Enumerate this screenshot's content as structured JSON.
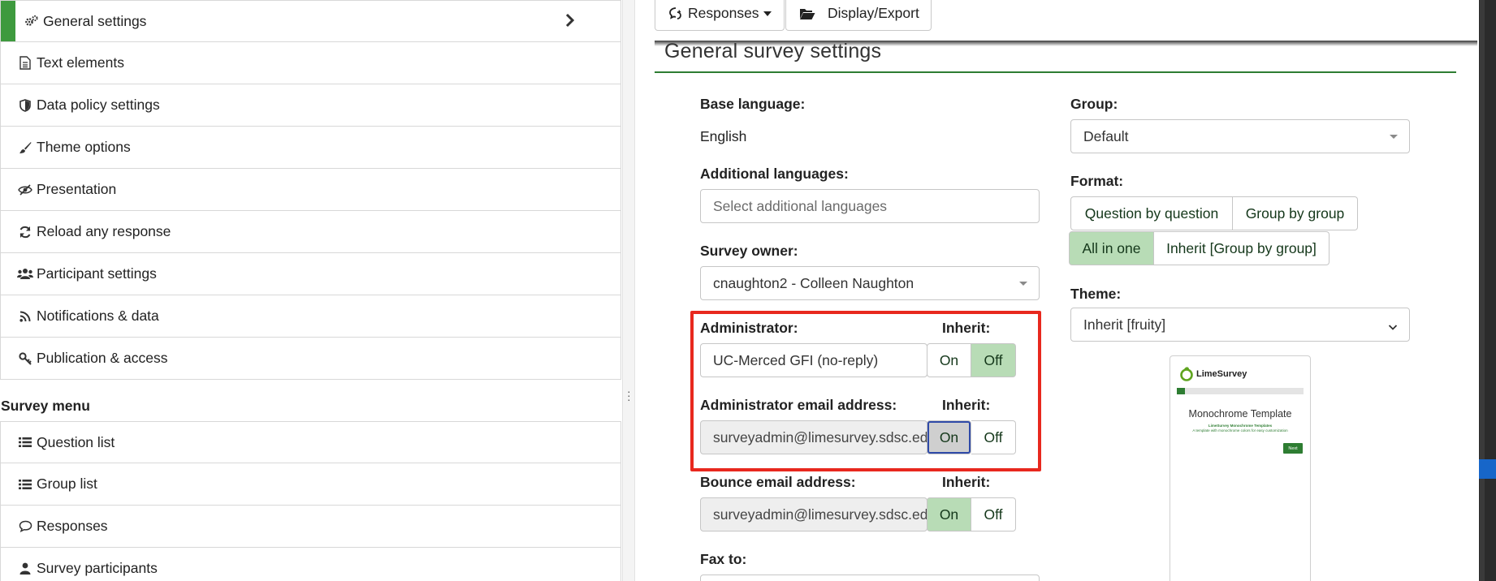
{
  "sidebar": {
    "items": [
      {
        "label": "General settings",
        "icon": "gears-icon"
      },
      {
        "label": "Text elements",
        "icon": "file-text-icon"
      },
      {
        "label": "Data policy settings",
        "icon": "shield-icon"
      },
      {
        "label": "Theme options",
        "icon": "paint-brush-icon"
      },
      {
        "label": "Presentation",
        "icon": "eye-slash-icon"
      },
      {
        "label": "Reload any response",
        "icon": "refresh-icon"
      },
      {
        "label": "Participant settings",
        "icon": "users-icon"
      },
      {
        "label": "Notifications & data",
        "icon": "rss-icon"
      },
      {
        "label": "Publication & access",
        "icon": "key-icon"
      }
    ],
    "survey_menu_heading": "Survey menu",
    "survey_menu": [
      {
        "label": "Question list",
        "icon": "list-icon"
      },
      {
        "label": "Group list",
        "icon": "list-icon"
      },
      {
        "label": "Responses",
        "icon": "comment-icon"
      },
      {
        "label": "Survey participants",
        "icon": "user-icon"
      }
    ],
    "accent_color": "#3e9a3e"
  },
  "toolbar": {
    "responses_label": "Responses",
    "display_export_label": "Display/Export"
  },
  "main": {
    "section_title": "General survey settings",
    "base_language_label": "Base language:",
    "base_language_value": "English",
    "additional_languages_label": "Additional languages:",
    "additional_languages_placeholder": "Select additional languages",
    "survey_owner_label": "Survey owner:",
    "survey_owner_value": "cnaughton2 - Colleen Naughton",
    "administrator_label": "Administrator:",
    "administrator_value": "UC-Merced GFI (no-reply)",
    "admin_email_label": "Administrator email address:",
    "admin_email_value": "surveyadmin@limesurvey.sdsc.edu",
    "bounce_email_label": "Bounce email address:",
    "bounce_email_value": "surveyadmin@limesurvey.sdsc.edu",
    "fax_label": "Fax to:",
    "inherit_label": "Inherit:",
    "on_label": "On",
    "off_label": "Off",
    "group_label": "Group:",
    "group_value": "Default",
    "format_label": "Format:",
    "format_options": [
      "Question by question",
      "Group by group",
      "All in one",
      "Inherit [Group by group]"
    ],
    "format_selected": "All in one",
    "theme_label": "Theme:",
    "theme_value": "Inherit [fruity]",
    "theme_preview": {
      "logo_text": "LimeSurvey",
      "title": "Monochrome Template",
      "subtitle_1": "LimeSurvey Monochrome Templates",
      "subtitle_2": "A template with monochrome colors for easy customization",
      "next_label": "Next"
    },
    "toggle_state": {
      "administrator_inherit": "Off",
      "admin_email_inherit": "On",
      "bounce_inherit": "On"
    },
    "colors": {
      "rule": "#2e7d32",
      "toggle_on": "#b8dcb6",
      "highlight": "#e8281e"
    }
  }
}
